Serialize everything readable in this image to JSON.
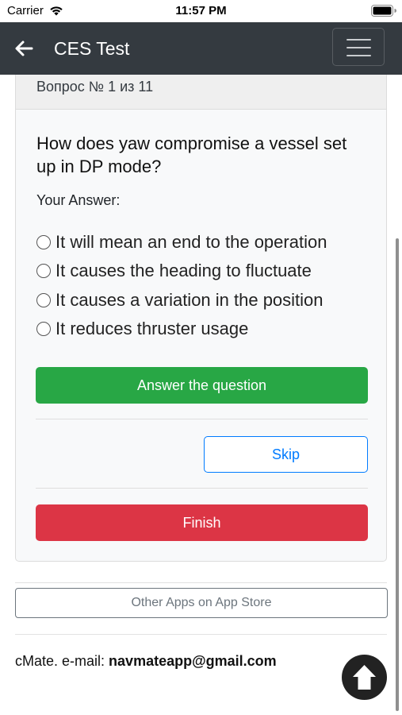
{
  "status_bar": {
    "carrier": "Carrier",
    "time": "11:57 PM"
  },
  "navbar": {
    "title": "CES Test",
    "background": "#343a40"
  },
  "quiz": {
    "progress": "Вопрос № 1 из 11",
    "question": "How does yaw compromise a vessel set up in DP mode?",
    "answer_label": "Your Answer:",
    "options": [
      "It will mean an end to the operation",
      "It causes the heading to fluctuate",
      "It causes a variation in the position",
      "It reduces thruster usage"
    ],
    "answer_button": "Answer the question",
    "skip_button": "Skip",
    "finish_button": "Finish"
  },
  "footer": {
    "other_apps_button": "Other Apps on App Store",
    "contact_prefix": "cMate. e-mail:",
    "email": "navmateapp@gmail.com"
  },
  "colors": {
    "success": "#28a745",
    "danger": "#dc3545",
    "primary": "#007bff",
    "secondary": "#6c757d"
  },
  "icons": {
    "back": "arrow-left-icon",
    "menu": "hamburger-menu-icon",
    "scroll_top": "arrow-up-icon"
  }
}
